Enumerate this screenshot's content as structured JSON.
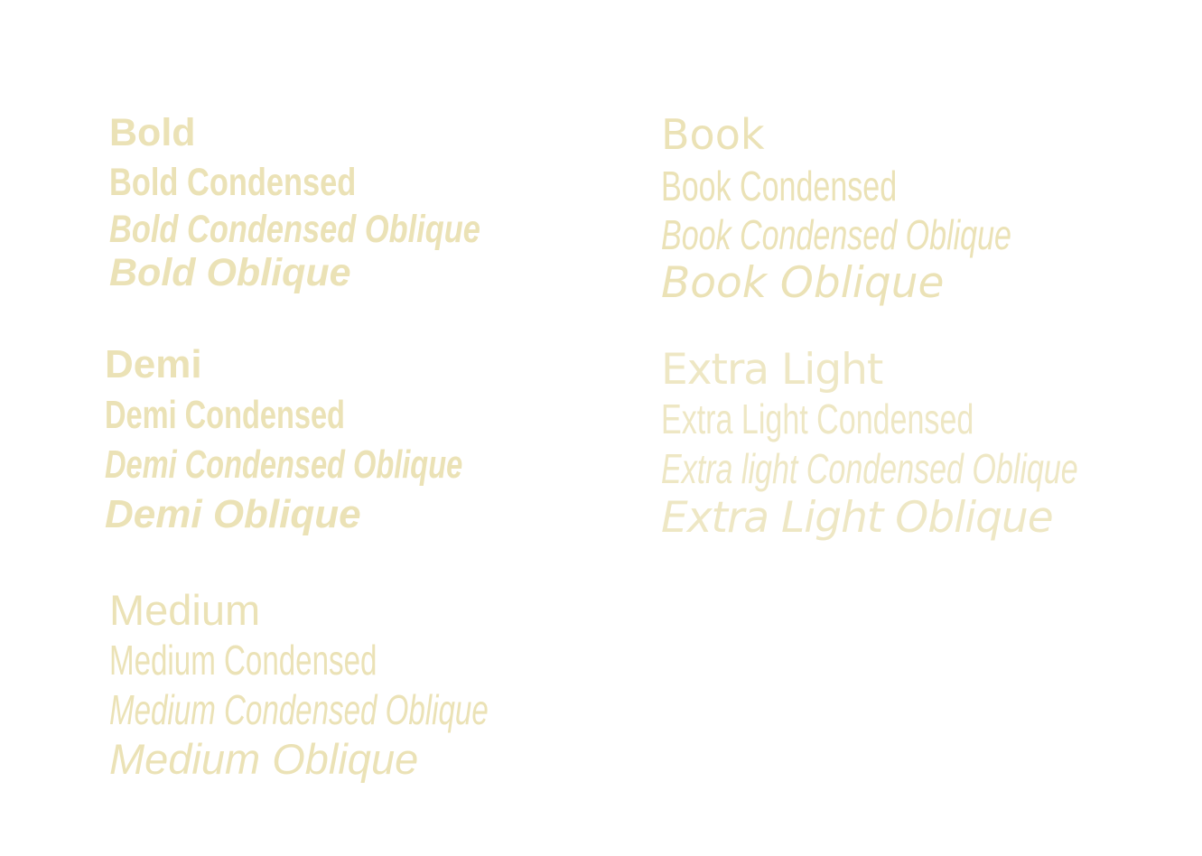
{
  "colors": {
    "background": "#ffffff",
    "text": "#ebe2b6",
    "text_light": "#eee7c4"
  },
  "groups": {
    "bold": [
      "Bold",
      "Bold Condensed",
      "Bold Condensed Oblique",
      "Bold Oblique"
    ],
    "demi": [
      "Demi",
      "Demi Condensed",
      "Demi Condensed Oblique",
      "Demi Oblique"
    ],
    "medium": [
      "Medium",
      "Medium Condensed",
      "Medium Condensed Oblique",
      "Medium Oblique"
    ],
    "book": [
      "Book",
      "Book Condensed",
      "Book Condensed Oblique",
      "Book Oblique"
    ],
    "extra_light": [
      "Extra Light",
      "Extra Light Condensed",
      "Extra light Condensed Oblique",
      "Extra Light Oblique"
    ]
  }
}
